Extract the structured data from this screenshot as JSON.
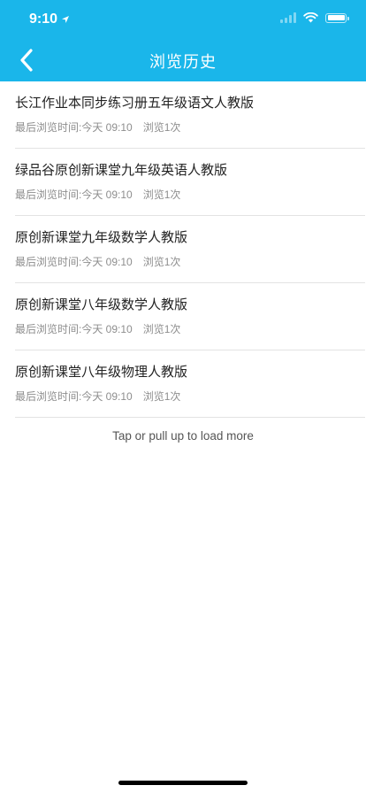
{
  "status_bar": {
    "time": "9:10",
    "location_icon": "location-arrow-icon",
    "signal_icon": "cellular-signal-icon",
    "wifi_icon": "wifi-icon",
    "battery_icon": "battery-icon"
  },
  "nav": {
    "title": "浏览历史",
    "back_icon": "chevron-left-icon"
  },
  "history": [
    {
      "title": "长江作业本同步练习册五年级语文人教版",
      "last_viewed": "最后浏览时间:今天 09:10",
      "view_count": "浏览1次"
    },
    {
      "title": "绿品谷原创新课堂九年级英语人教版",
      "last_viewed": "最后浏览时间:今天 09:10",
      "view_count": "浏览1次"
    },
    {
      "title": "原创新课堂九年级数学人教版",
      "last_viewed": "最后浏览时间:今天 09:10",
      "view_count": "浏览1次"
    },
    {
      "title": "原创新课堂八年级数学人教版",
      "last_viewed": "最后浏览时间:今天 09:10",
      "view_count": "浏览1次"
    },
    {
      "title": "原创新课堂八年级物理人教版",
      "last_viewed": "最后浏览时间:今天 09:10",
      "view_count": "浏览1次"
    }
  ],
  "load_more": "Tap or pull up to load more",
  "colors": {
    "header": "#1ab6ea",
    "title_text": "#222222",
    "meta_text": "#8e8e8e",
    "divider": "#e3e3e3"
  }
}
